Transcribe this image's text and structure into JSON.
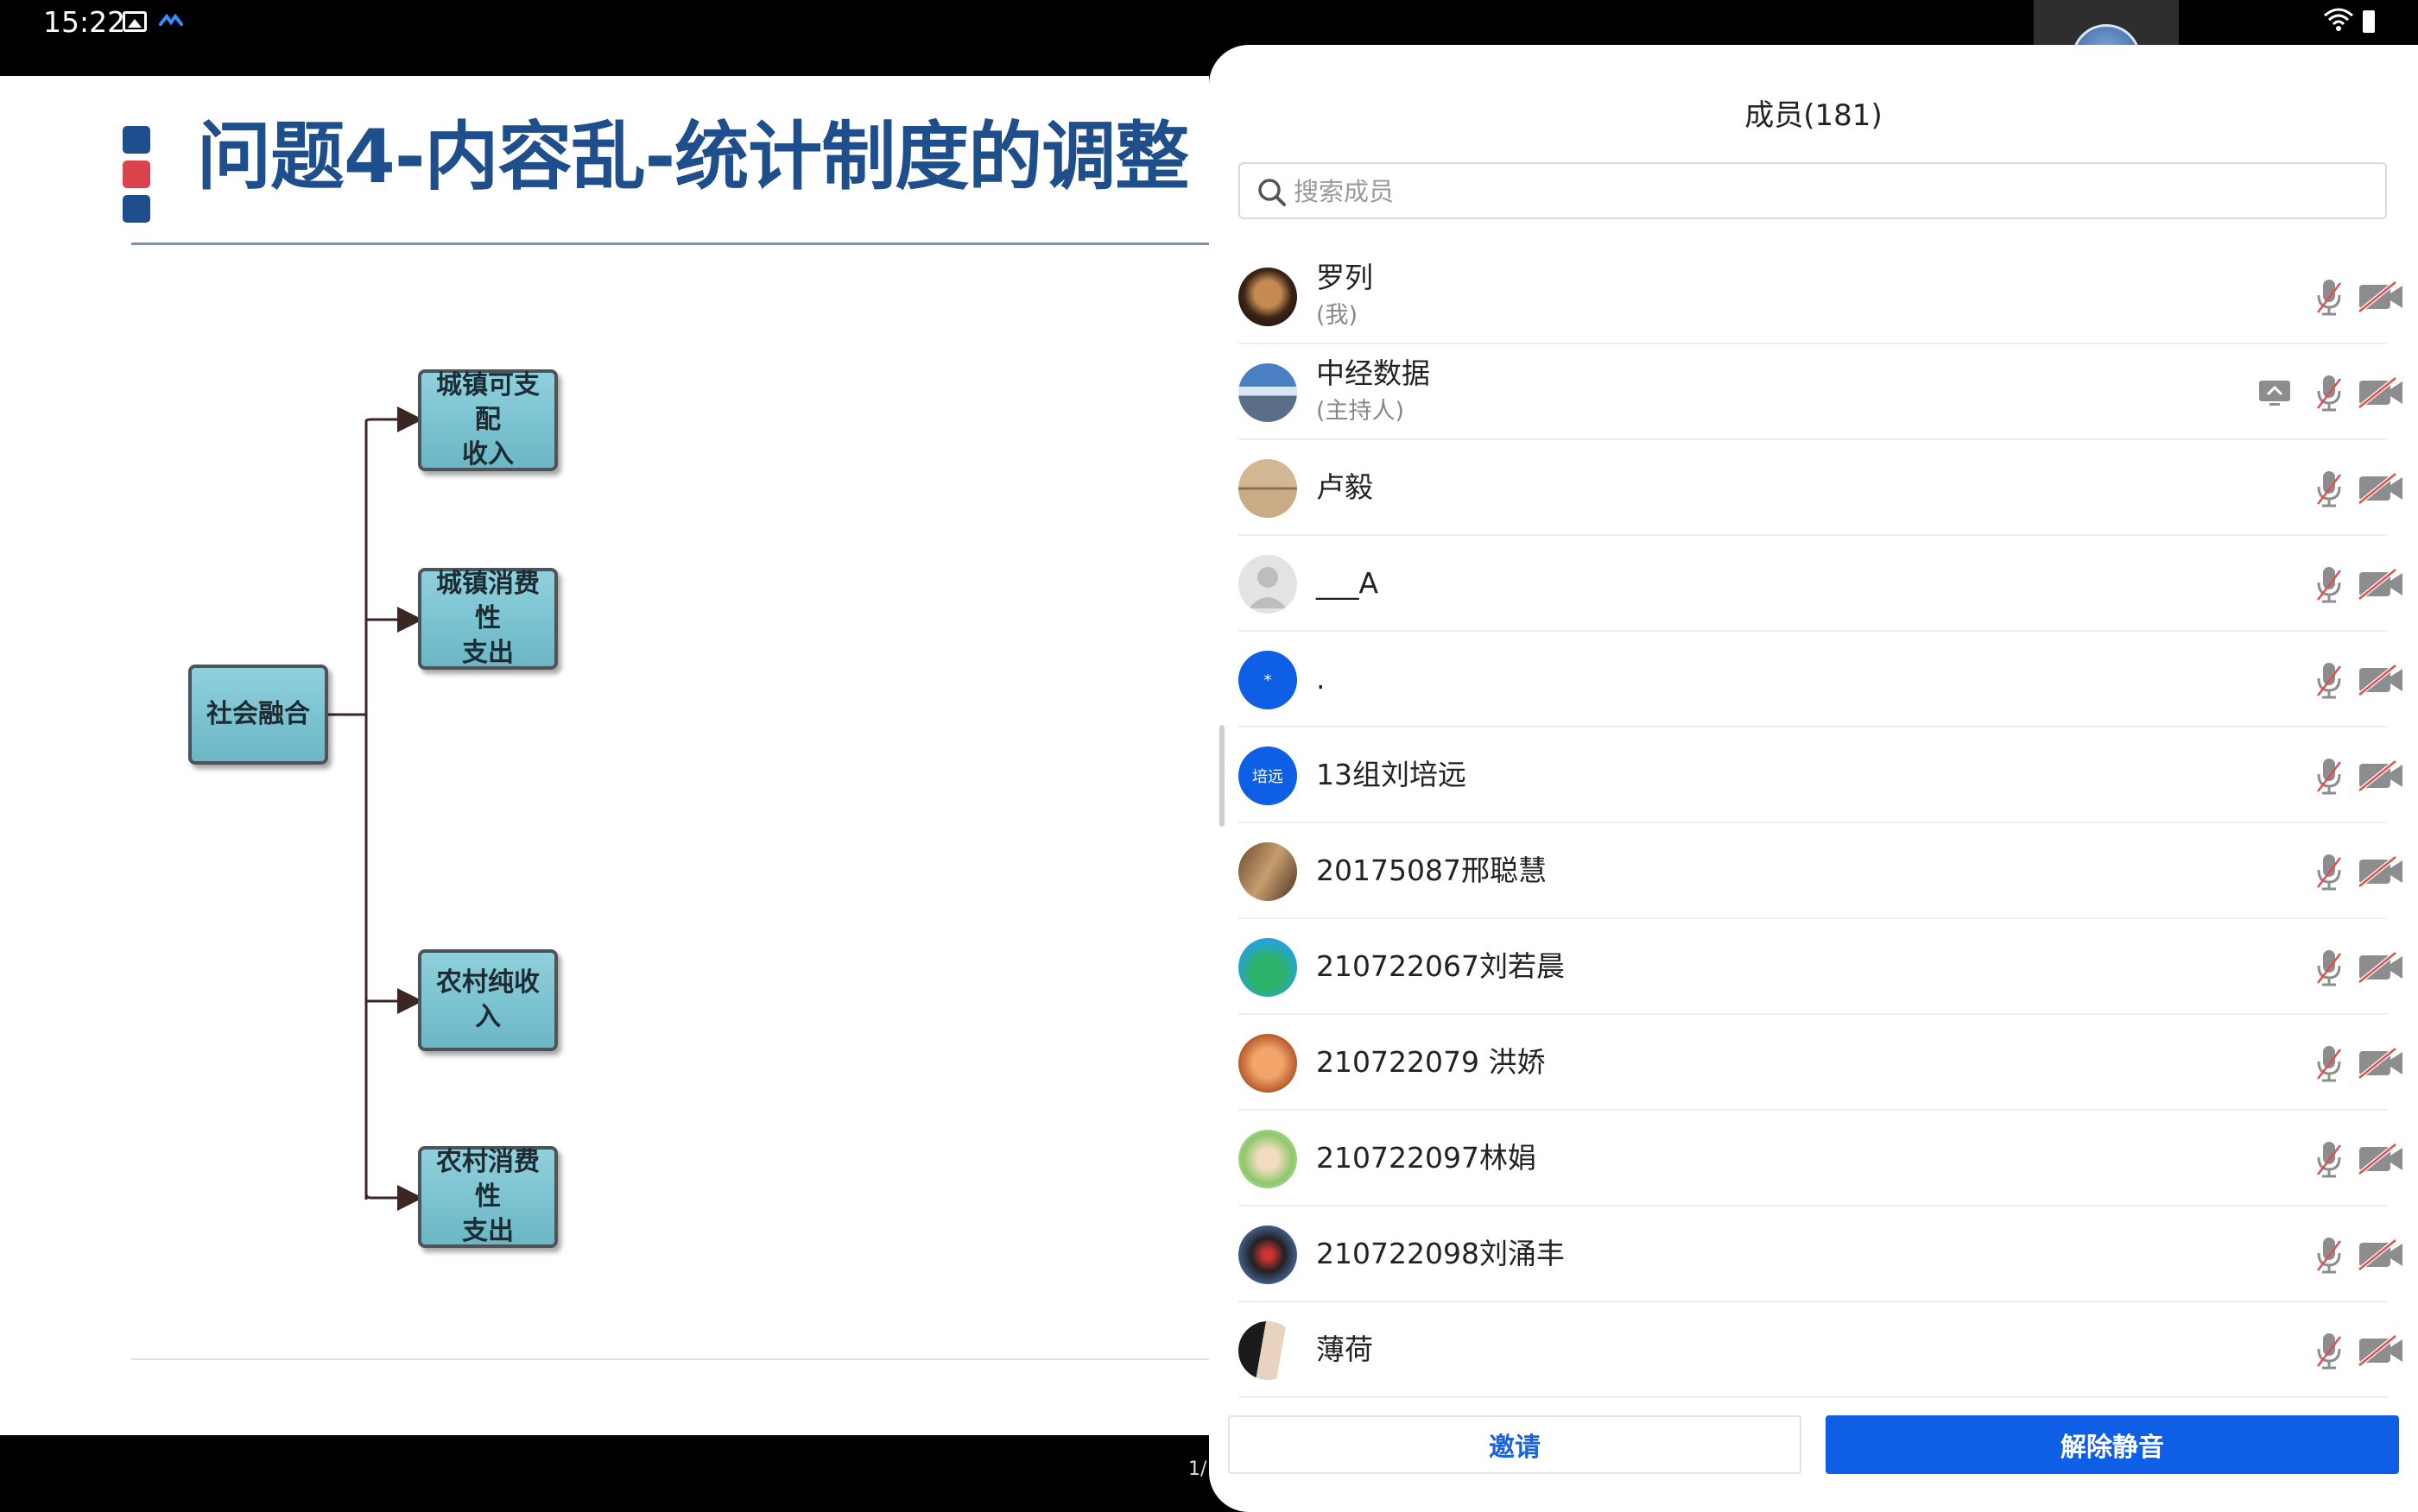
{
  "status_bar": {
    "time": "15:22"
  },
  "slide": {
    "title": "问题4-内容乱-统计制度的调整",
    "bullet_colors": [
      "#1f4e8c",
      "#d9434d",
      "#1f4e8c"
    ],
    "root_node": "社会融合",
    "child_nodes": [
      {
        "line1": "城镇可支配",
        "line2": "收入"
      },
      {
        "line1": "城镇消费性",
        "line2": "支出"
      },
      {
        "line1": "农村纯收入",
        "line2": ""
      },
      {
        "line1": "农村消费性",
        "line2": "支出"
      }
    ],
    "page_indicator": "1/"
  },
  "panel": {
    "title": "成员(181)",
    "search_placeholder": "搜索成员",
    "invite_label": "邀请",
    "unmute_label": "解除静音",
    "accent_color": "#0e5ee6",
    "members": [
      {
        "name": "罗列",
        "role": "(我)",
        "avatar": "photo-dark-face",
        "sharing": false
      },
      {
        "name": "中经数据",
        "role": "(主持人)",
        "avatar": "photo-landscape",
        "sharing": true
      },
      {
        "name": "卢毅",
        "role": "",
        "avatar": "photo-beige",
        "sharing": false
      },
      {
        "name": "___A",
        "role": "",
        "avatar": "default-person",
        "sharing": false
      },
      {
        "name": ".",
        "role": "",
        "avatar": "blue-initial",
        "avatar_text": "*",
        "sharing": false
      },
      {
        "name": "13组刘培远",
        "role": "",
        "avatar": "blue-initial",
        "avatar_text": "培远",
        "sharing": false
      },
      {
        "name": "20175087邢聪慧",
        "role": "",
        "avatar": "photo-brown",
        "sharing": false
      },
      {
        "name": "210722067刘若晨",
        "role": "",
        "avatar": "photo-nature",
        "sharing": false
      },
      {
        "name": "210722079 洪娇",
        "role": "",
        "avatar": "photo-orange",
        "sharing": false
      },
      {
        "name": "210722097林娟",
        "role": "",
        "avatar": "photo-green",
        "sharing": false
      },
      {
        "name": "210722098刘涌丰",
        "role": "",
        "avatar": "photo-night",
        "sharing": false
      },
      {
        "name": "薄荷",
        "role": "",
        "avatar": "photo-portrait",
        "sharing": false
      }
    ]
  }
}
